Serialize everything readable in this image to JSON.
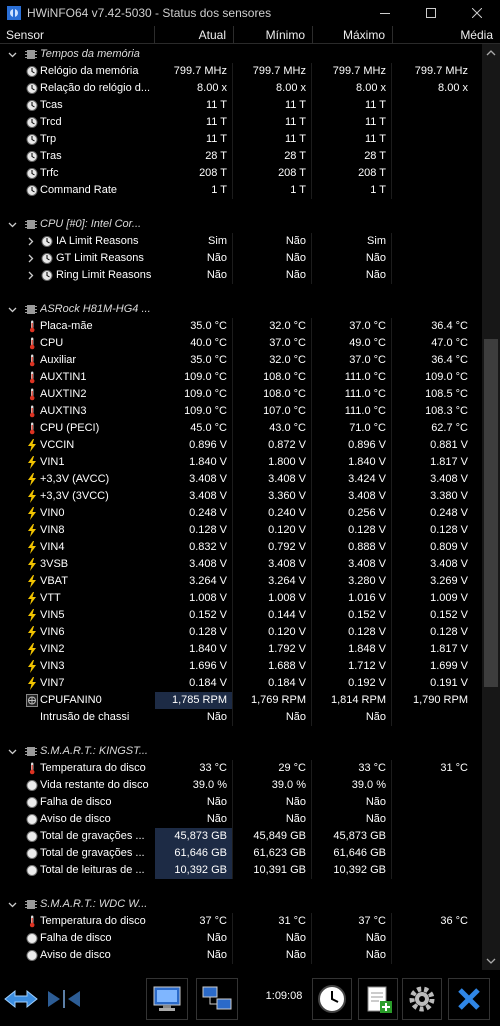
{
  "window": {
    "title": "HWiNFO64 v7.42-5030 - Status dos sensores"
  },
  "columns": [
    "Sensor",
    "Atual",
    "Mínimo",
    "Máximo",
    "Média"
  ],
  "groups": [
    {
      "name": "Tempos da memória",
      "icon": "memory-chip-icon",
      "rows": [
        {
          "name": "Relógio da memória",
          "icon": "clock-icon",
          "v": [
            "799.7 MHz",
            "799.7 MHz",
            "799.7 MHz",
            "799.7 MHz"
          ]
        },
        {
          "name": "Relação do relógio d...",
          "icon": "clock-icon",
          "v": [
            "8.00 x",
            "8.00 x",
            "8.00 x",
            "8.00 x"
          ]
        },
        {
          "name": "Tcas",
          "icon": "clock-icon",
          "v": [
            "11 T",
            "11 T",
            "11 T",
            ""
          ]
        },
        {
          "name": "Trcd",
          "icon": "clock-icon",
          "v": [
            "11 T",
            "11 T",
            "11 T",
            ""
          ]
        },
        {
          "name": "Trp",
          "icon": "clock-icon",
          "v": [
            "11 T",
            "11 T",
            "11 T",
            ""
          ]
        },
        {
          "name": "Tras",
          "icon": "clock-icon",
          "v": [
            "28 T",
            "28 T",
            "28 T",
            ""
          ]
        },
        {
          "name": "Trfc",
          "icon": "clock-icon",
          "v": [
            "208 T",
            "208 T",
            "208 T",
            ""
          ]
        },
        {
          "name": "Command Rate",
          "icon": "clock-icon",
          "v": [
            "1 T",
            "1 T",
            "1 T",
            ""
          ]
        }
      ]
    },
    {
      "name": "CPU [#0]: Intel Cor...",
      "icon": "cpu-chip-icon",
      "rows": [
        {
          "name": "IA Limit Reasons",
          "icon": "clock-icon",
          "expander": true,
          "v": [
            "Sim",
            "Não",
            "Sim",
            ""
          ]
        },
        {
          "name": "GT Limit Reasons",
          "icon": "clock-icon",
          "expander": true,
          "v": [
            "Não",
            "Não",
            "Não",
            ""
          ]
        },
        {
          "name": "Ring Limit Reasons",
          "icon": "clock-icon",
          "expander": true,
          "v": [
            "Não",
            "Não",
            "Não",
            ""
          ]
        }
      ]
    },
    {
      "name": "ASRock H81M-HG4 ...",
      "icon": "motherboard-chip-icon",
      "rows": [
        {
          "name": "Placa-mãe",
          "icon": "thermometer-icon",
          "v": [
            "35.0 °C",
            "32.0 °C",
            "37.0 °C",
            "36.4 °C"
          ]
        },
        {
          "name": "CPU",
          "icon": "thermometer-icon",
          "v": [
            "40.0 °C",
            "37.0 °C",
            "49.0 °C",
            "47.0 °C"
          ]
        },
        {
          "name": "Auxiliar",
          "icon": "thermometer-icon",
          "v": [
            "35.0 °C",
            "32.0 °C",
            "37.0 °C",
            "36.4 °C"
          ]
        },
        {
          "name": "AUXTIN1",
          "icon": "thermometer-icon",
          "v": [
            "109.0 °C",
            "108.0 °C",
            "111.0 °C",
            "109.0 °C"
          ]
        },
        {
          "name": "AUXTIN2",
          "icon": "thermometer-icon",
          "v": [
            "109.0 °C",
            "108.0 °C",
            "111.0 °C",
            "108.5 °C"
          ]
        },
        {
          "name": "AUXTIN3",
          "icon": "thermometer-icon",
          "v": [
            "109.0 °C",
            "107.0 °C",
            "111.0 °C",
            "108.3 °C"
          ]
        },
        {
          "name": "CPU (PECI)",
          "icon": "thermometer-icon",
          "v": [
            "45.0 °C",
            "43.0 °C",
            "71.0 °C",
            "62.7 °C"
          ]
        },
        {
          "name": "VCCIN",
          "icon": "lightning-icon",
          "v": [
            "0.896 V",
            "0.872 V",
            "0.896 V",
            "0.881 V"
          ]
        },
        {
          "name": "VIN1",
          "icon": "lightning-icon",
          "v": [
            "1.840 V",
            "1.800 V",
            "1.840 V",
            "1.817 V"
          ]
        },
        {
          "name": "+3,3V (AVCC)",
          "icon": "lightning-icon",
          "v": [
            "3.408 V",
            "3.408 V",
            "3.424 V",
            "3.408 V"
          ]
        },
        {
          "name": "+3,3V (3VCC)",
          "icon": "lightning-icon",
          "v": [
            "3.408 V",
            "3.360 V",
            "3.408 V",
            "3.380 V"
          ]
        },
        {
          "name": "VIN0",
          "icon": "lightning-icon",
          "v": [
            "0.248 V",
            "0.240 V",
            "0.256 V",
            "0.248 V"
          ]
        },
        {
          "name": "VIN8",
          "icon": "lightning-icon",
          "v": [
            "0.128 V",
            "0.120 V",
            "0.128 V",
            "0.128 V"
          ]
        },
        {
          "name": "VIN4",
          "icon": "lightning-icon",
          "v": [
            "0.832 V",
            "0.792 V",
            "0.888 V",
            "0.809 V"
          ]
        },
        {
          "name": "3VSB",
          "icon": "lightning-icon",
          "v": [
            "3.408 V",
            "3.408 V",
            "3.408 V",
            "3.408 V"
          ]
        },
        {
          "name": "VBAT",
          "icon": "lightning-icon",
          "v": [
            "3.264 V",
            "3.264 V",
            "3.280 V",
            "3.269 V"
          ]
        },
        {
          "name": "VTT",
          "icon": "lightning-icon",
          "v": [
            "1.008 V",
            "1.008 V",
            "1.016 V",
            "1.009 V"
          ]
        },
        {
          "name": "VIN5",
          "icon": "lightning-icon",
          "v": [
            "0.152 V",
            "0.144 V",
            "0.152 V",
            "0.152 V"
          ]
        },
        {
          "name": "VIN6",
          "icon": "lightning-icon",
          "v": [
            "0.128 V",
            "0.120 V",
            "0.128 V",
            "0.128 V"
          ]
        },
        {
          "name": "VIN2",
          "icon": "lightning-icon",
          "v": [
            "1.840 V",
            "1.792 V",
            "1.848 V",
            "1.817 V"
          ]
        },
        {
          "name": "VIN3",
          "icon": "lightning-icon",
          "v": [
            "1.696 V",
            "1.688 V",
            "1.712 V",
            "1.699 V"
          ]
        },
        {
          "name": "VIN7",
          "icon": "lightning-icon",
          "v": [
            "0.184 V",
            "0.184 V",
            "0.192 V",
            "0.191 V"
          ]
        },
        {
          "name": "CPUFANIN0",
          "icon": "fan-icon",
          "v": [
            "1,785 RPM",
            "1,769 RPM",
            "1,814 RPM",
            "1,790 RPM"
          ],
          "hl": true
        },
        {
          "name": "Intrusão de chassi",
          "icon": "none",
          "v": [
            "Não",
            "Não",
            "Não",
            ""
          ]
        }
      ]
    },
    {
      "name": "S.M.A.R.T.: KINGST...",
      "icon": "drive-chip-icon",
      "rows": [
        {
          "name": "Temperatura do disco",
          "icon": "thermometer-icon",
          "v": [
            "33 °C",
            "29 °C",
            "33 °C",
            "31 °C"
          ]
        },
        {
          "name": "Vida restante do disco",
          "icon": "status-circle-icon",
          "v": [
            "39.0 %",
            "39.0 %",
            "39.0 %",
            ""
          ]
        },
        {
          "name": "Falha de disco",
          "icon": "status-circle-icon",
          "v": [
            "Não",
            "Não",
            "Não",
            ""
          ]
        },
        {
          "name": "Aviso de disco",
          "icon": "status-circle-icon",
          "v": [
            "Não",
            "Não",
            "Não",
            ""
          ]
        },
        {
          "name": "Total de gravações ...",
          "icon": "status-circle-icon",
          "v": [
            "45,873 GB",
            "45,849 GB",
            "45,873 GB",
            ""
          ],
          "hl": true
        },
        {
          "name": "Total de gravações ...",
          "icon": "status-circle-icon",
          "v": [
            "61,646 GB",
            "61,623 GB",
            "61,646 GB",
            ""
          ],
          "hl": true
        },
        {
          "name": "Total de leituras de ...",
          "icon": "status-circle-icon",
          "v": [
            "10,392 GB",
            "10,391 GB",
            "10,392 GB",
            ""
          ],
          "hl": true
        }
      ]
    },
    {
      "name": "S.M.A.R.T.: WDC W...",
      "icon": "drive-chip-icon",
      "rows": [
        {
          "name": "Temperatura do disco",
          "icon": "thermometer-icon",
          "v": [
            "37 °C",
            "31 °C",
            "37 °C",
            "36 °C"
          ]
        },
        {
          "name": "Falha de disco",
          "icon": "status-circle-icon",
          "v": [
            "Não",
            "Não",
            "Não",
            ""
          ]
        },
        {
          "name": "Aviso de disco",
          "icon": "status-circle-icon",
          "v": [
            "Não",
            "Não",
            "Não",
            ""
          ]
        }
      ]
    }
  ],
  "toolbar": {
    "time": "1:09:08"
  },
  "colors": {
    "background": "#000000",
    "text": "#ffffff",
    "highlight": "#1d2b45"
  }
}
